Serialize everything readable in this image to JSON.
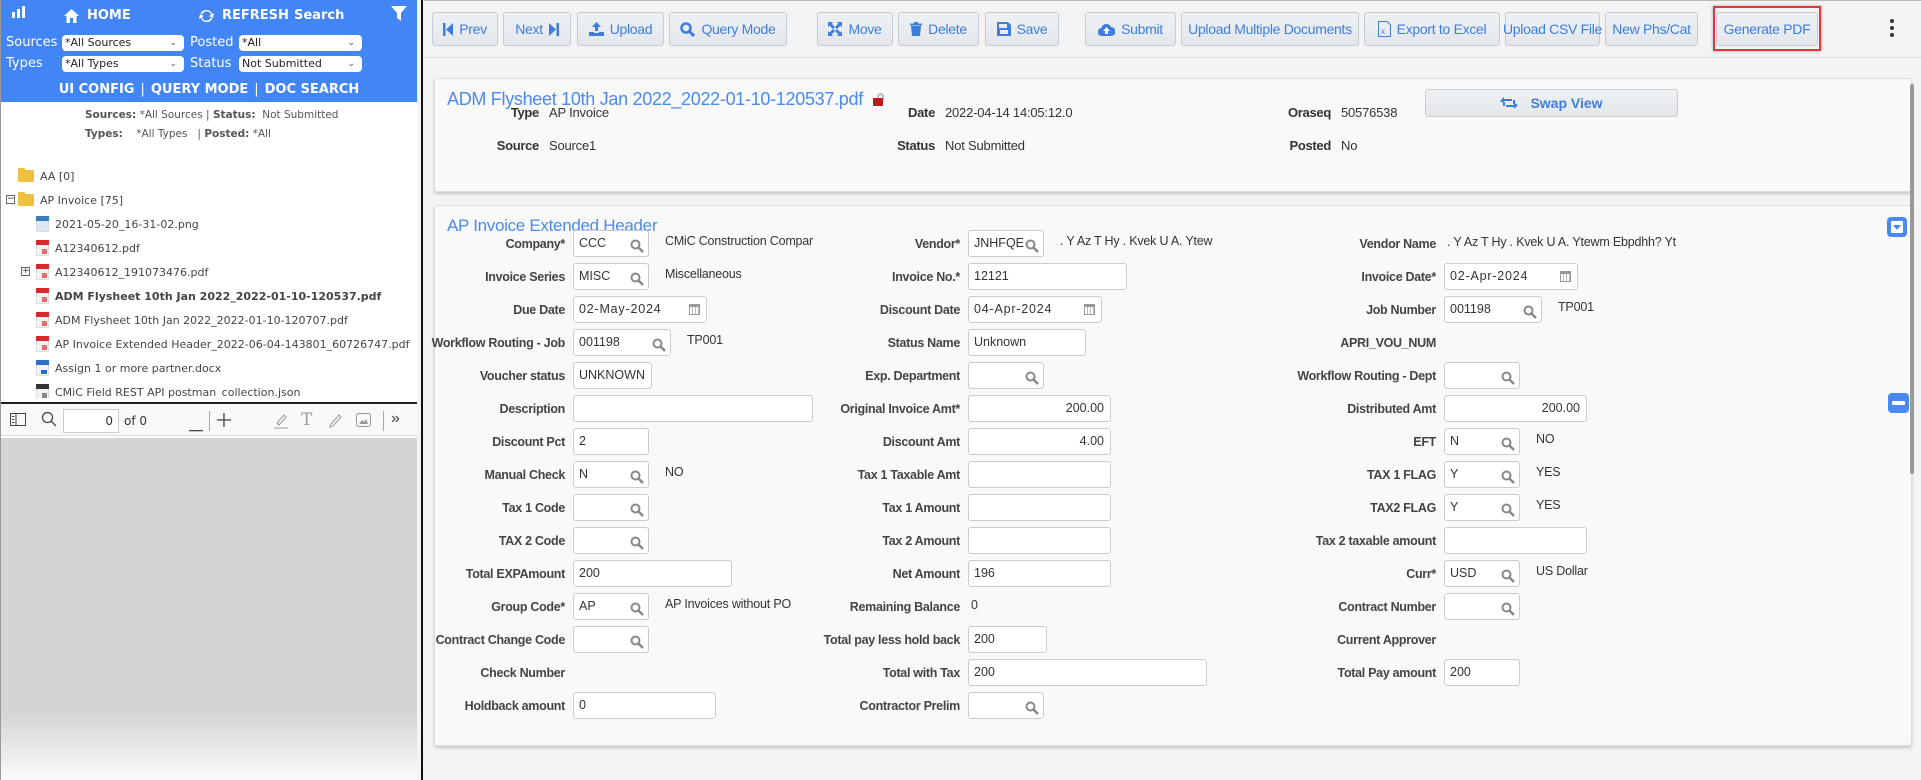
{
  "left_panel": {
    "header": {
      "home_label": "HOME",
      "refresh_label": "REFRESH",
      "search_label": "Search",
      "sources_label": "Sources",
      "sources_value": "*All Sources",
      "posted_label": "Posted",
      "posted_value": "*All",
      "types_label": "Types",
      "types_value": "*All Types",
      "status_label": "Status",
      "status_value": "Not Submitted",
      "links": [
        "UI CONFIG",
        "QUERY MODE",
        "DOC SEARCH"
      ]
    },
    "summary": {
      "sources_label": "Sources:",
      "sources_value": "*All Sources",
      "status_label": "Status:",
      "status_value": "Not Submitted",
      "types_label": "Types:",
      "types_value": "*All Types",
      "posted_label": "Posted:",
      "posted_value": "*All"
    },
    "tree": [
      {
        "label": "AA [0]",
        "type": "folder"
      },
      {
        "label": "AP Invoice [75]",
        "type": "folder",
        "expanded": true
      },
      {
        "label": "2021-05-20_16-31-02.png",
        "type": "png"
      },
      {
        "label": "A12340612.pdf",
        "type": "pdf"
      },
      {
        "label": "A12340612_191073476.pdf",
        "type": "pdf",
        "expandable": true
      },
      {
        "label": "ADM Flysheet 10th Jan 2022_2022-01-10-120537.pdf",
        "type": "pdf",
        "selected": true
      },
      {
        "label": "ADM Flysheet 10th Jan 2022_2022-01-10-120707.pdf",
        "type": "pdf"
      },
      {
        "label": "AP Invoice Extended Header_2022-06-04-143801_60726747.pdf",
        "type": "pdf"
      },
      {
        "label": "Assign 1 or more partner.docx",
        "type": "doc"
      },
      {
        "label": "CMiC Field REST API postman_collection.json",
        "type": "json"
      }
    ],
    "pdf_toolbar": {
      "page_value": "0",
      "page_of": "of 0"
    }
  },
  "toolbar": {
    "prev": "Prev",
    "next": "Next",
    "upload": "Upload",
    "query_mode": "Query Mode",
    "move": "Move",
    "delete": "Delete",
    "save": "Save",
    "submit": "Submit",
    "upload_multiple": "Upload Multiple Documents",
    "export_excel": "Export to Excel",
    "upload_csv": "Upload CSV File",
    "new_phs_cat": "New Phs/Cat",
    "generate_pdf": "Generate PDF"
  },
  "doc_header": {
    "title": "ADM Flysheet 10th Jan 2022_2022-01-10-120537.pdf",
    "swap_view": "Swap View",
    "type_label": "Type",
    "type_value": "AP Invoice",
    "source_label": "Source",
    "source_value": "Source1",
    "date_label": "Date",
    "date_value": "2022-04-14 14:05:12.0",
    "status_label": "Status",
    "status_value": "Not Submitted",
    "oraseq_label": "Oraseq",
    "oraseq_value": "50576538",
    "posted_label": "Posted",
    "posted_value": "No"
  },
  "extended_header": {
    "title": "AP Invoice Extended Header",
    "col1": [
      {
        "label": "Company*",
        "value": "CCC",
        "kind": "lookup",
        "desc": "CMiC Construction Compar"
      },
      {
        "label": "Invoice Series",
        "value": "MISC",
        "kind": "lookup",
        "desc": "Miscellaneous"
      },
      {
        "label": "Due Date",
        "value": "02-May-2024",
        "kind": "date"
      },
      {
        "label": "Workflow Routing - Job",
        "value": "001198",
        "kind": "lookup-wide",
        "desc": "TP001"
      },
      {
        "label": "Voucher status",
        "value": "UNKNOWN",
        "kind": "text-sm"
      },
      {
        "label": "Description",
        "value": "",
        "kind": "text-xl"
      },
      {
        "label": "Discount Pct",
        "value": "2",
        "kind": "text-sm2"
      },
      {
        "label": "Manual Check",
        "value": "N",
        "kind": "lookup",
        "desc": "NO"
      },
      {
        "label": "Tax 1 Code",
        "value": "",
        "kind": "lookup"
      },
      {
        "label": "TAX 2 Code",
        "value": "",
        "kind": "lookup"
      },
      {
        "label": "Total EXPAmount",
        "value": "200",
        "kind": "text-lg"
      },
      {
        "label": "Group Code*",
        "value": "AP",
        "kind": "lookup",
        "desc": "AP Invoices without PO"
      },
      {
        "label": "Contract Change Code",
        "value": "",
        "kind": "lookup"
      },
      {
        "label": "Check Number",
        "value": null,
        "kind": "none"
      },
      {
        "label": "Holdback amount",
        "value": "0",
        "kind": "text-md"
      }
    ],
    "col2": [
      {
        "label": "Vendor*",
        "value": "JNHFQE",
        "kind": "lookup",
        "desc": ".   Y Az T Hy . Kvek U A. Ytew"
      },
      {
        "label": "Invoice No.*",
        "value": "12121",
        "kind": "text-lg"
      },
      {
        "label": "Discount Date",
        "value": "04-Apr-2024",
        "kind": "date"
      },
      {
        "label": "Status Name",
        "value": "Unknown",
        "kind": "text-md2"
      },
      {
        "label": "Exp. Department",
        "value": "",
        "kind": "lookup"
      },
      {
        "label": "Original Invoice Amt*",
        "value": "200.00",
        "kind": "num"
      },
      {
        "label": "Discount Amt",
        "value": "4.00",
        "kind": "num"
      },
      {
        "label": "Tax 1 Taxable Amt",
        "value": "",
        "kind": "num"
      },
      {
        "label": "Tax 1 Amount",
        "value": "",
        "kind": "num"
      },
      {
        "label": "Tax 2 Amount",
        "value": "",
        "kind": "num"
      },
      {
        "label": "Net Amount",
        "value": "196",
        "kind": "text-num"
      },
      {
        "label": "Remaining Balance",
        "value": "0",
        "kind": "static"
      },
      {
        "label": "Total pay less hold back",
        "value": "200",
        "kind": "text-sm3"
      },
      {
        "label": "Total with Tax",
        "value": "200",
        "kind": "text-xxl"
      },
      {
        "label": "Contractor Prelim",
        "value": "",
        "kind": "lookup"
      }
    ],
    "col3": [
      {
        "label": "Vendor Name",
        "value": ".   Y Az T Hy . Kvek U A. Ytewm Ebpdhh? Yt",
        "kind": "static"
      },
      {
        "label": "Invoice Date*",
        "value": "02-Apr-2024",
        "kind": "date"
      },
      {
        "label": "Job Number",
        "value": "001198",
        "kind": "lookup-wide",
        "desc": "TP001"
      },
      {
        "label": "APRI_VOU_NUM",
        "value": null,
        "kind": "none"
      },
      {
        "label": "Workflow Routing - Dept",
        "value": "",
        "kind": "lookup"
      },
      {
        "label": "Distributed Amt",
        "value": "200.00",
        "kind": "num"
      },
      {
        "label": "EFT",
        "value": "N",
        "kind": "lookup",
        "desc": "NO"
      },
      {
        "label": "TAX 1 FLAG",
        "value": "Y",
        "kind": "lookup",
        "desc": "YES"
      },
      {
        "label": "TAX2 FLAG",
        "value": "Y",
        "kind": "lookup",
        "desc": "YES"
      },
      {
        "label": "Tax 2 taxable amount",
        "value": "",
        "kind": "num"
      },
      {
        "label": "Curr*",
        "value": "USD",
        "kind": "lookup",
        "desc": "US Dollar"
      },
      {
        "label": "Contract Number",
        "value": "",
        "kind": "lookup"
      },
      {
        "label": "Current Approver",
        "value": null,
        "kind": "none"
      },
      {
        "label": "Total Pay amount",
        "value": "200",
        "kind": "text-sm2"
      }
    ]
  },
  "colors": {
    "brand_blue": "#4285f4",
    "link_blue": "#4a8af0",
    "highlight_red": "#e8323c"
  }
}
